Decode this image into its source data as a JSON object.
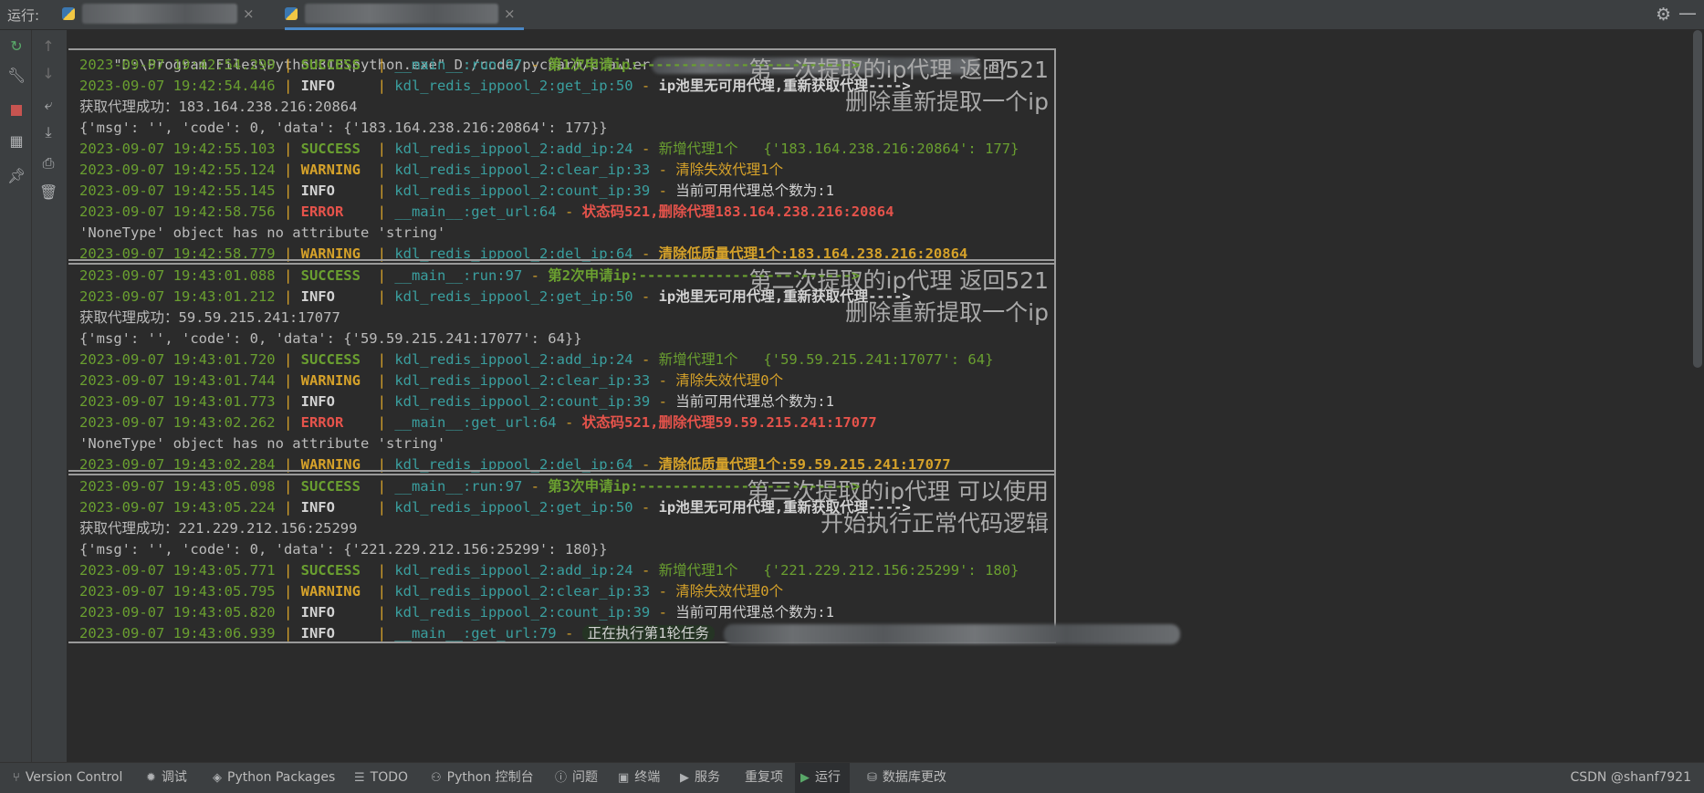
{
  "runbar": {
    "label": "运行:",
    "tab_close": "×",
    "settings_icon": "gear-icon",
    "minimize_icon": "minimize-icon"
  },
  "command_line": {
    "text_left": "\"D:\\Program Files\\Python310\\python.exe\" D:/code/pycharm/crawler",
    "text_right": ".py"
  },
  "sections": [
    {
      "annotation": [
        "第一次提取的ip代理 返回521",
        "删除重新提取一个ip"
      ],
      "lines": [
        {
          "kind": "log",
          "date": "2023-09-07 19:42:54.299",
          "level": "SUCCESS",
          "module": "__main__:run:97",
          "msg": "第1次申请ip:------------------------->"
        },
        {
          "kind": "log",
          "date": "2023-09-07 19:42:54.446",
          "level": "INFO",
          "module": "kdl_redis_ippool_2:get_ip:50",
          "msg": "ip池里无可用代理,重新获取代理---->"
        },
        {
          "kind": "plain",
          "text": "获取代理成功：183.164.238.216:20864"
        },
        {
          "kind": "plain",
          "text": "{'msg': '', 'code': 0, 'data': {'183.164.238.216:20864': 177}}"
        },
        {
          "kind": "log",
          "date": "2023-09-07 19:42:55.103",
          "level": "SUCCESS",
          "module": "kdl_redis_ippool_2:add_ip:24",
          "msg": "新增代理1个   {'183.164.238.216:20864': 177}"
        },
        {
          "kind": "log",
          "date": "2023-09-07 19:42:55.124",
          "level": "WARNING",
          "module": "kdl_redis_ippool_2:clear_ip:33",
          "msg": "清除失效代理1个"
        },
        {
          "kind": "log",
          "date": "2023-09-07 19:42:55.145",
          "level": "INFO",
          "module": "kdl_redis_ippool_2:count_ip:39",
          "msg": "当前可用代理总个数为:1"
        },
        {
          "kind": "log",
          "date": "2023-09-07 19:42:58.756",
          "level": "ERROR",
          "module": "__main__:get_url:64",
          "msg": "状态码521,删除代理183.164.238.216:20864"
        },
        {
          "kind": "plain",
          "text": "'NoneType' object has no attribute 'string'"
        },
        {
          "kind": "log",
          "date": "2023-09-07 19:42:58.779",
          "level": "WARNING",
          "module": "kdl_redis_ippool_2:del_ip:64",
          "msg": "清除低质量代理1个:183.164.238.216:20864"
        }
      ]
    },
    {
      "annotation": [
        "第二次提取的ip代理 返回521",
        "删除重新提取一个ip"
      ],
      "lines": [
        {
          "kind": "log",
          "date": "2023-09-07 19:43:01.088",
          "level": "SUCCESS",
          "module": "__main__:run:97",
          "msg": "第2次申请ip:------------------------->"
        },
        {
          "kind": "log",
          "date": "2023-09-07 19:43:01.212",
          "level": "INFO",
          "module": "kdl_redis_ippool_2:get_ip:50",
          "msg": "ip池里无可用代理,重新获取代理---->"
        },
        {
          "kind": "plain",
          "text": "获取代理成功：59.59.215.241:17077"
        },
        {
          "kind": "plain",
          "text": "{'msg': '', 'code': 0, 'data': {'59.59.215.241:17077': 64}}"
        },
        {
          "kind": "log",
          "date": "2023-09-07 19:43:01.720",
          "level": "SUCCESS",
          "module": "kdl_redis_ippool_2:add_ip:24",
          "msg": "新增代理1个   {'59.59.215.241:17077': 64}"
        },
        {
          "kind": "log",
          "date": "2023-09-07 19:43:01.744",
          "level": "WARNING",
          "module": "kdl_redis_ippool_2:clear_ip:33",
          "msg": "清除失效代理0个"
        },
        {
          "kind": "log",
          "date": "2023-09-07 19:43:01.773",
          "level": "INFO",
          "module": "kdl_redis_ippool_2:count_ip:39",
          "msg": "当前可用代理总个数为:1"
        },
        {
          "kind": "log",
          "date": "2023-09-07 19:43:02.262",
          "level": "ERROR",
          "module": "__main__:get_url:64",
          "msg": "状态码521,删除代理59.59.215.241:17077"
        },
        {
          "kind": "plain",
          "text": "'NoneType' object has no attribute 'string'"
        },
        {
          "kind": "log",
          "date": "2023-09-07 19:43:02.284",
          "level": "WARNING",
          "module": "kdl_redis_ippool_2:del_ip:64",
          "msg": "清除低质量代理1个:59.59.215.241:17077"
        }
      ]
    },
    {
      "annotation": [
        "第三次提取的ip代理 可以使用",
        "开始执行正常代码逻辑"
      ],
      "lines": [
        {
          "kind": "log",
          "date": "2023-09-07 19:43:05.098",
          "level": "SUCCESS",
          "module": "__main__:run:97",
          "msg": "第3次申请ip:------------------------->"
        },
        {
          "kind": "log",
          "date": "2023-09-07 19:43:05.224",
          "level": "INFO",
          "module": "kdl_redis_ippool_2:get_ip:50",
          "msg": "ip池里无可用代理,重新获取代理---->"
        },
        {
          "kind": "plain",
          "text": "获取代理成功：221.229.212.156:25299"
        },
        {
          "kind": "plain",
          "text": "{'msg': '', 'code': 0, 'data': {'221.229.212.156:25299': 180}}"
        },
        {
          "kind": "log",
          "date": "2023-09-07 19:43:05.771",
          "level": "SUCCESS",
          "module": "kdl_redis_ippool_2:add_ip:24",
          "msg": "新增代理1个   {'221.229.212.156:25299': 180}"
        },
        {
          "kind": "log",
          "date": "2023-09-07 19:43:05.795",
          "level": "WARNING",
          "module": "kdl_redis_ippool_2:clear_ip:33",
          "msg": "清除失效代理0个"
        },
        {
          "kind": "log",
          "date": "2023-09-07 19:43:05.820",
          "level": "INFO",
          "module": "kdl_redis_ippool_2:count_ip:39",
          "msg": "当前可用代理总个数为:1"
        },
        {
          "kind": "log",
          "date": "2023-09-07 19:43:06.939",
          "level": "INFO",
          "module": "__main__:get_url:79",
          "msg": "正在执行第1轮任务"
        }
      ]
    }
  ],
  "log_separator": " | ",
  "log_dash": " - ",
  "bottom_tabs": [
    {
      "label": "Version Control",
      "icon": "branch-icon"
    },
    {
      "label": "调试",
      "icon": "bug-icon"
    },
    {
      "label": "Python Packages",
      "icon": "layers-icon"
    },
    {
      "label": "TODO",
      "icon": "list-icon"
    },
    {
      "label": "Python 控制台",
      "icon": "python-icon"
    },
    {
      "label": "问题",
      "icon": "info-icon"
    },
    {
      "label": "终端",
      "icon": "terminal-icon"
    },
    {
      "label": "服务",
      "icon": "play-circle-icon"
    },
    {
      "label": "重复项",
      "icon": ""
    },
    {
      "label": "运行",
      "icon": "run-icon",
      "active": true
    },
    {
      "label": "数据库更改",
      "icon": "database-icon"
    }
  ],
  "watermark": "CSDN @shanf7921"
}
